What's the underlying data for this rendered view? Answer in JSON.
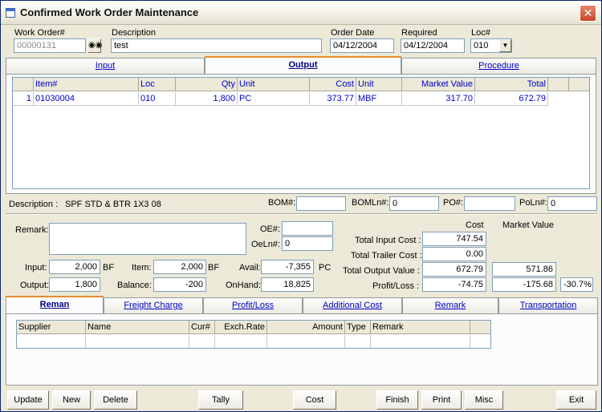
{
  "window": {
    "title": "Confirmed Work Order Maintenance",
    "close_glyph": "✕"
  },
  "header": {
    "work_order_label": "Work Order#",
    "work_order_value": "00000131",
    "description_label": "Description",
    "description_value": "test",
    "order_date_label": "Order Date",
    "order_date_value": "04/12/2004",
    "required_label": "Required",
    "required_value": "04/12/2004",
    "loc_label": "Loc#",
    "loc_value": "010",
    "lookup_icon": "binoculars-icon"
  },
  "top_tabs": [
    "Input",
    "Output",
    "Procedure"
  ],
  "output_grid": {
    "columns": [
      "Item#",
      "Loc",
      "Qty",
      "Unit",
      "Cost",
      "Unit",
      "Market Value",
      "Total"
    ],
    "rows": [
      {
        "num": "1",
        "item": "01030004",
        "loc": "010",
        "qty": "1,800",
        "unit": "PC",
        "cost": "373.77",
        "cost_unit": "MBF",
        "market_value": "317.70",
        "total": "672.79"
      }
    ]
  },
  "desc_line": {
    "label": "Description :",
    "value": "SPF STD & BTR  1X3 08",
    "bom_label": "BOM#:",
    "bom_value": "",
    "bomln_label": "BOMLn#:",
    "bomln_value": "0",
    "po_label": "PO#:",
    "po_value": "",
    "poln_label": "PoLn#:",
    "poln_value": "0"
  },
  "detail": {
    "remark_label": "Remark:",
    "remark_value": "",
    "oe_label": "OE#:",
    "oe_value": "",
    "oeln_label": "OeLn#:",
    "oeln_value": "0",
    "input_label": "Input:",
    "input_value": "2,000",
    "input_unit": "BF",
    "item_label": "Item:",
    "item_value": "2,000",
    "item_unit": "BF",
    "avail_label": "Avail:",
    "avail_value": "-7,355",
    "avail_unit": "PC",
    "output_label": "Output:",
    "output_value": "1,800",
    "balance_label": "Balance:",
    "balance_value": "-200",
    "onhand_label": "OnHand:",
    "onhand_value": "18,825"
  },
  "totals": {
    "cost_header": "Cost",
    "market_header": "Market Value",
    "input_cost_label": "Total Input Cost :",
    "input_cost_value": "747.54",
    "trailer_cost_label": "Total Trailer Cost :",
    "trailer_cost_value": "0.00",
    "output_value_label": "Total Output Value :",
    "output_value_cost": "672.79",
    "output_value_market": "571.86",
    "profit_loss_label": "Profit/Loss :",
    "profit_loss_cost": "-74.75",
    "profit_loss_market": "-175.68",
    "profit_loss_pct": "-30.7%"
  },
  "bottom_tabs": [
    "Reman",
    "Freight Charge",
    "Profit/Loss",
    "Additional Cost",
    "Remark",
    "Transportation"
  ],
  "reman_grid": {
    "columns": [
      "Supplier",
      "Name",
      "Cur#",
      "Exch.Rate",
      "Amount",
      "Type",
      "Remark"
    ]
  },
  "buttons": [
    "Update",
    "New",
    "Delete",
    "Tally",
    "Cost",
    "Finish",
    "Print",
    "Misc",
    "Exit"
  ]
}
